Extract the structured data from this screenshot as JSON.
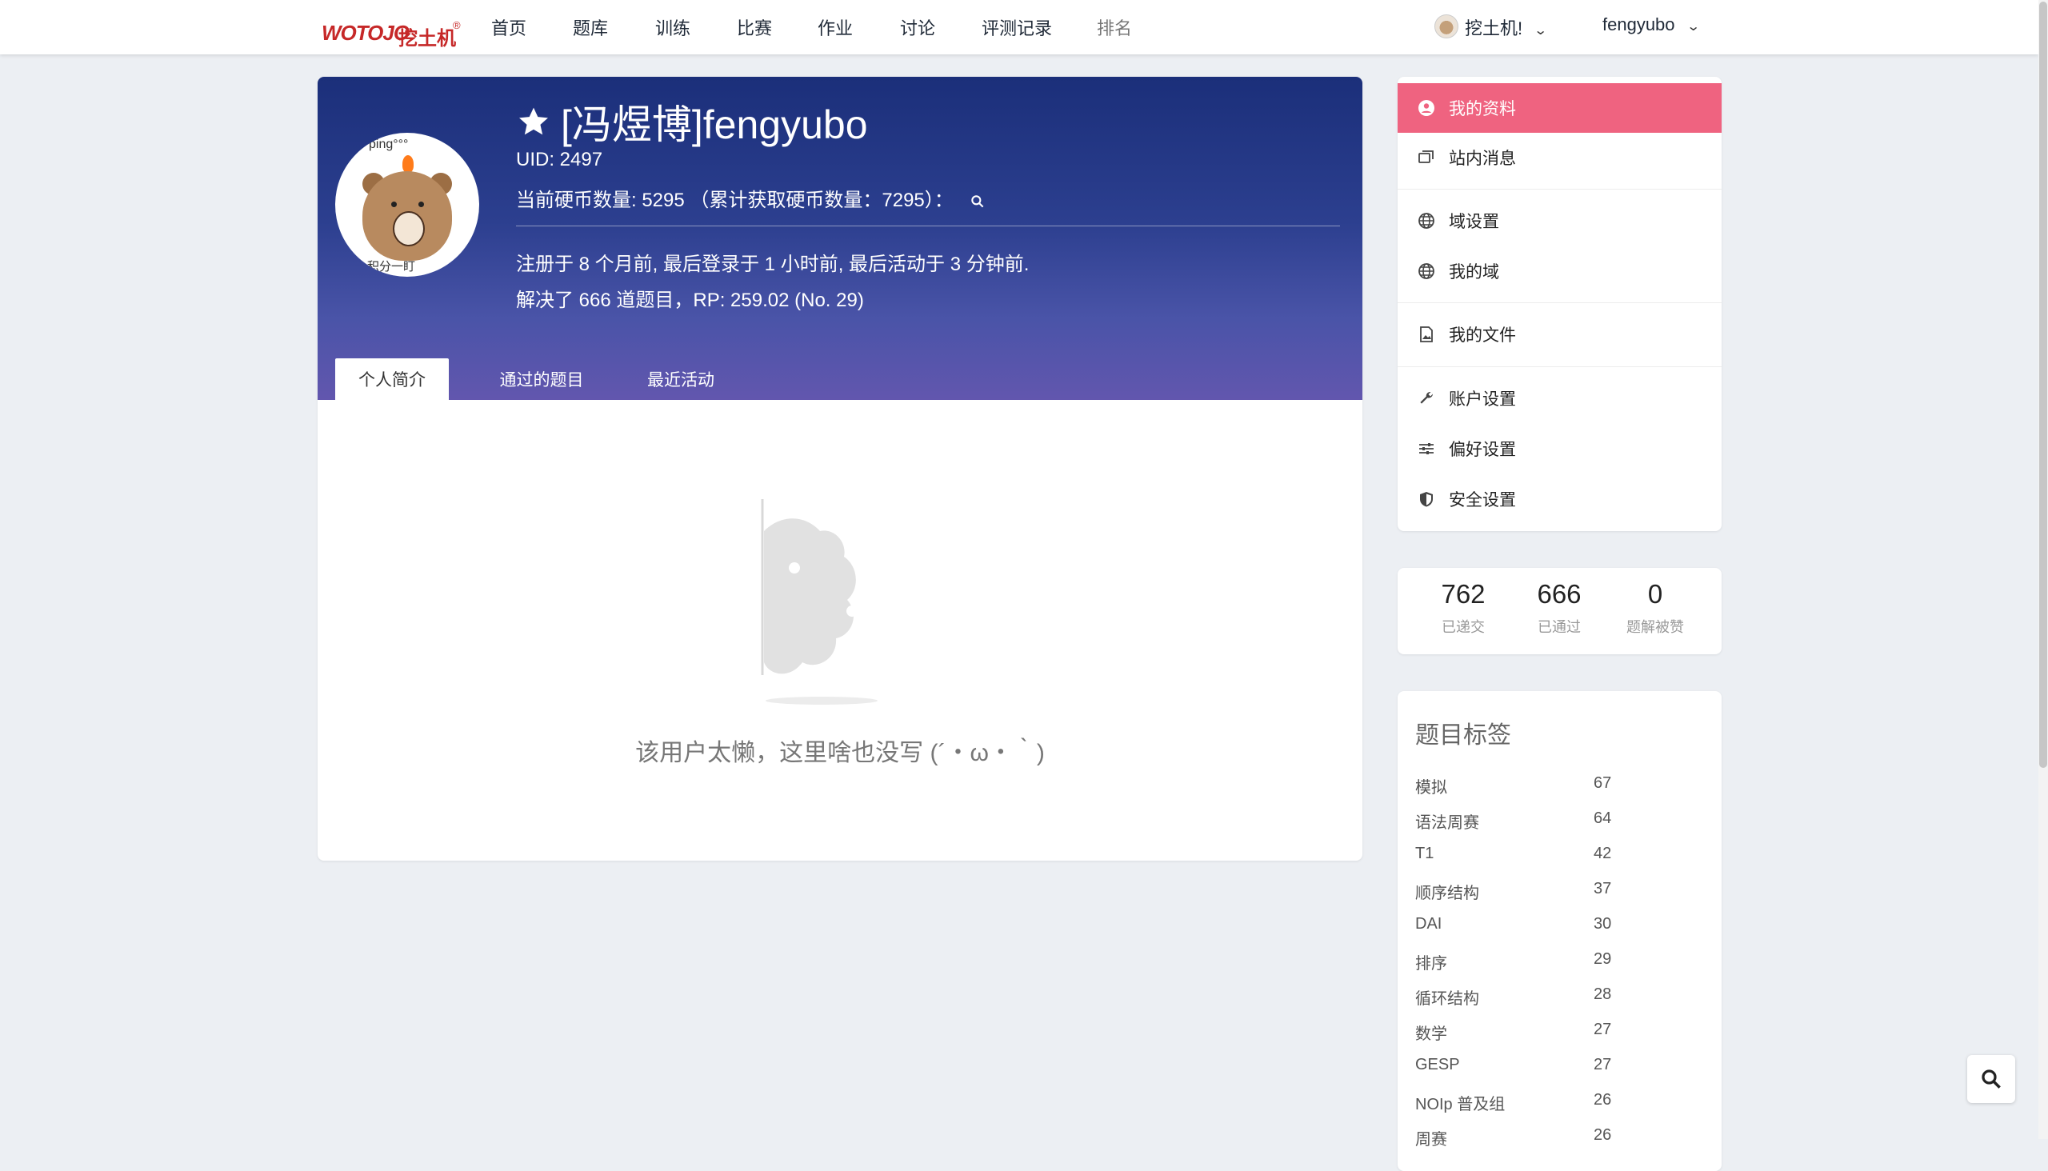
{
  "logo": {
    "en": "WOTOJO",
    "cn": "挖土机",
    "mark": "®"
  },
  "nav": {
    "items": [
      {
        "label": "首页"
      },
      {
        "label": "题库"
      },
      {
        "label": "训练"
      },
      {
        "label": "比赛"
      },
      {
        "label": "作业"
      },
      {
        "label": "讨论"
      },
      {
        "label": "评测记录"
      },
      {
        "label": "排名"
      }
    ],
    "domain_label": "挖土机!",
    "user_label": "fengyubo"
  },
  "profile": {
    "name": "[冯煜博]fengyubo",
    "uid": "UID: 2497",
    "coins": "当前硬币数量: 5295 （累计获取硬币数量：7295）：",
    "activity": "注册于 8 个月前, 最后登录于 1 小时前, 最后活动于 3 分钟前.",
    "solved": "解决了 666 道题目，RP: 259.02 (No. 29)",
    "avatar_text_top": "ping°°°",
    "avatar_text_bottom": "积分一盯",
    "tabs": [
      {
        "label": "个人简介"
      },
      {
        "label": "通过的题目"
      },
      {
        "label": "最近活动"
      }
    ],
    "empty_text": "该用户太懒，这里啥也没写 (´・ω・｀)"
  },
  "sidebar": {
    "menu": [
      {
        "label": "我的资料",
        "icon": "user-circle-icon",
        "active": true
      },
      {
        "label": "站内消息",
        "icon": "messages-icon"
      },
      {
        "label": "域设置",
        "icon": "globe-icon"
      },
      {
        "label": "我的域",
        "icon": "globe-icon"
      },
      {
        "label": "我的文件",
        "icon": "file-image-icon"
      },
      {
        "label": "账户设置",
        "icon": "wrench-icon"
      },
      {
        "label": "偏好设置",
        "icon": "sliders-icon"
      },
      {
        "label": "安全设置",
        "icon": "shield-icon"
      }
    ],
    "stats": [
      {
        "value": "762",
        "label": "已递交"
      },
      {
        "value": "666",
        "label": "已通过"
      },
      {
        "value": "0",
        "label": "题解被赞"
      }
    ],
    "tags_title": "题目标签",
    "tags": [
      {
        "name": "模拟",
        "count": "67"
      },
      {
        "name": "语法周赛",
        "count": "64"
      },
      {
        "name": "T1",
        "count": "42"
      },
      {
        "name": "顺序结构",
        "count": "37"
      },
      {
        "name": "DAI",
        "count": "30"
      },
      {
        "name": "排序",
        "count": "29"
      },
      {
        "name": "循环结构",
        "count": "28"
      },
      {
        "name": "数学",
        "count": "27"
      },
      {
        "name": "GESP",
        "count": "27"
      },
      {
        "name": "NOIp 普及组",
        "count": "26"
      },
      {
        "name": "周赛",
        "count": "26"
      }
    ]
  },
  "colors": {
    "accent": "#ef6380",
    "banner_top": "#1b2f7a",
    "banner_bottom": "#6256ae",
    "logo": "#c62828"
  }
}
